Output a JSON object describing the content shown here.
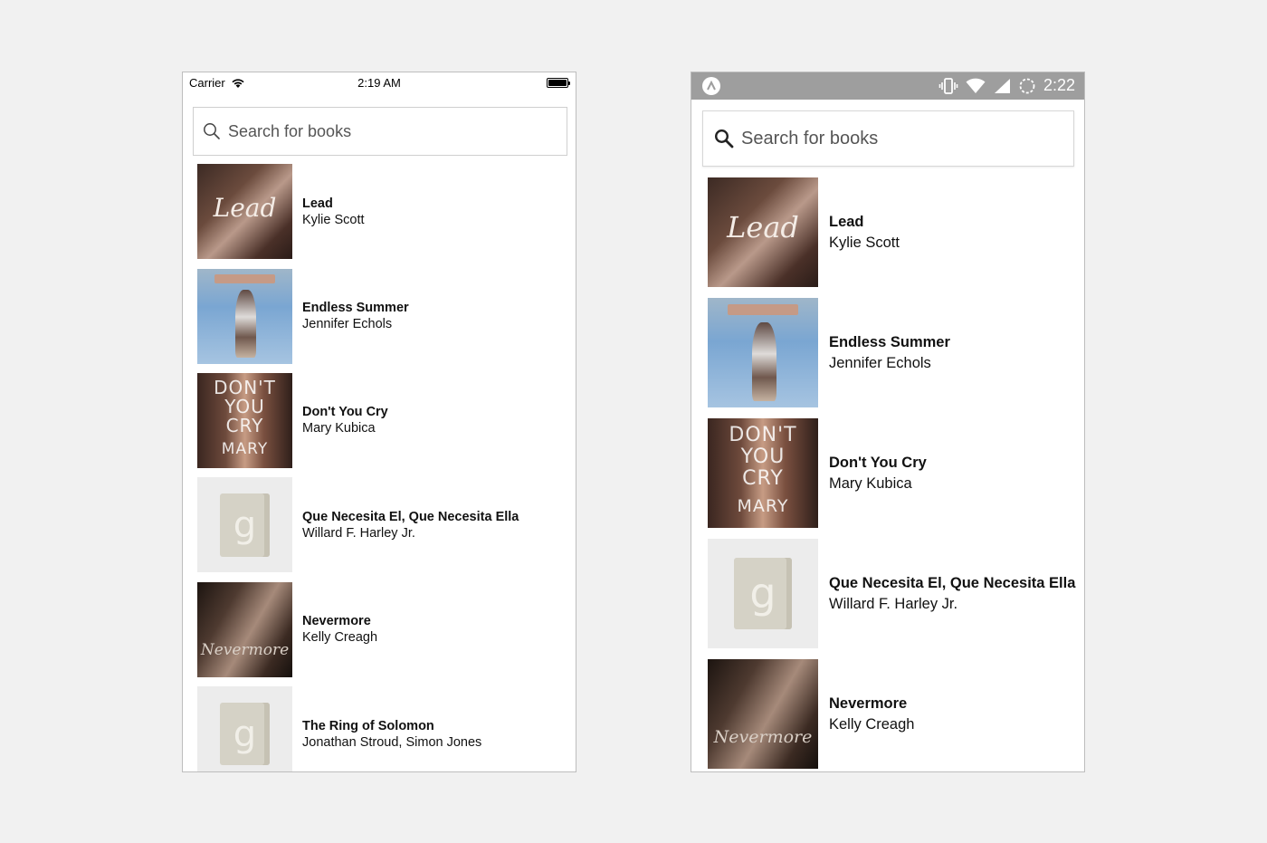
{
  "ios": {
    "status": {
      "carrier": "Carrier",
      "time": "2:19 AM"
    },
    "search": {
      "placeholder": "Search for books"
    },
    "books": [
      {
        "title": "Lead",
        "author": "Kylie Scott",
        "cover": "lead-cover"
      },
      {
        "title": "Endless Summer",
        "author": "Jennifer Echols",
        "cover": "endless-summer-cover"
      },
      {
        "title": "Don't You Cry",
        "author": "Mary Kubica",
        "cover": "dont-you-cry-cover"
      },
      {
        "title": "Que Necesita El, Que Necesita Ella",
        "author": "Willard F. Harley Jr.",
        "cover": "placeholder-g-cover"
      },
      {
        "title": "Nevermore",
        "author": "Kelly Creagh",
        "cover": "nevermore-cover"
      },
      {
        "title": "The Ring of Solomon",
        "author": "Jonathan Stroud, Simon  Jones",
        "cover": "placeholder-g-cover"
      }
    ]
  },
  "android": {
    "status": {
      "time": "2:22",
      "icons": [
        "notification-icon",
        "vibrate-icon",
        "wifi-icon",
        "signal-icon",
        "battery-icon"
      ]
    },
    "search": {
      "placeholder": "Search for books"
    },
    "books": [
      {
        "title": "Lead",
        "author": "Kylie Scott",
        "cover": "lead-cover"
      },
      {
        "title": "Endless Summer",
        "author": "Jennifer Echols",
        "cover": "endless-summer-cover"
      },
      {
        "title": "Don't You Cry",
        "author": "Mary Kubica",
        "cover": "dont-you-cry-cover"
      },
      {
        "title": "Que Necesita El, Que Necesita Ella",
        "author": "Willard F. Harley Jr.",
        "cover": "placeholder-g-cover"
      },
      {
        "title": "Nevermore",
        "author": "Kelly Creagh",
        "cover": "nevermore-cover"
      }
    ]
  },
  "cover_text": {
    "lead": "Lead",
    "cry_lines": [
      "DON'T",
      "YOU",
      "CRY",
      "MARY"
    ],
    "placeholder_letter": "g",
    "nevermore": "Nevermore"
  }
}
